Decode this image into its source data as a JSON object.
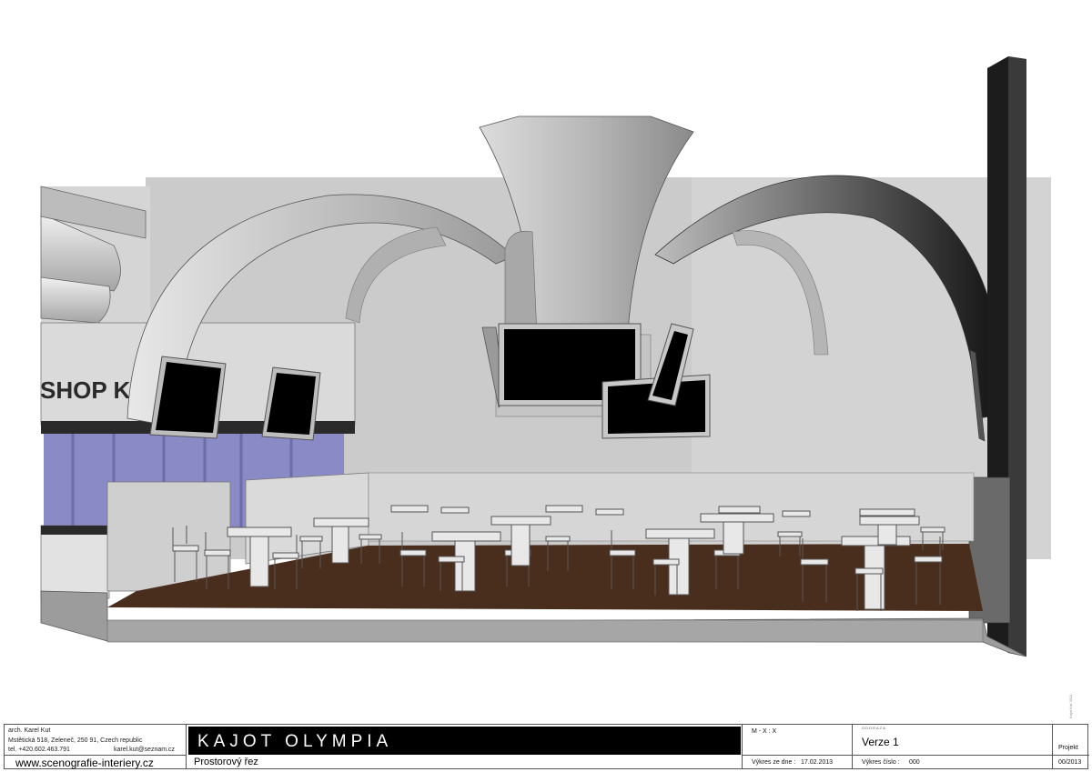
{
  "drawing": {
    "sign_text": "SHOP K",
    "vertical_note": "Kajot Kuř 2011",
    "colors": {
      "floor": "#4a2e1d",
      "wall": "#c9c9c9",
      "screen": "#000000",
      "glass": "#8888c4",
      "dark_wall": "#1c1c1c"
    }
  },
  "title_block": {
    "author": {
      "name": "arch. Karel Kut",
      "address": "Mstětická 518, Zeleneč, 250 91, Czech republic",
      "phone": "tel. +420.602.463.791",
      "email": "karel.kut@seznam.cz",
      "website": "www.scenografie-interiery.cz"
    },
    "project_name": "KAJOT OLYMPIA",
    "drawing_type": "Prostorový řez",
    "scale": "M - X : X",
    "drawn_date_label": "Výkres ze dne :",
    "drawn_date": "17.02.2013",
    "version_label": "ODORAZA",
    "version": "Verze 1",
    "drawing_no_label": "Výkres číslo :",
    "drawing_no": "000",
    "project_label": "Projekt",
    "project_no": "00/2013"
  }
}
